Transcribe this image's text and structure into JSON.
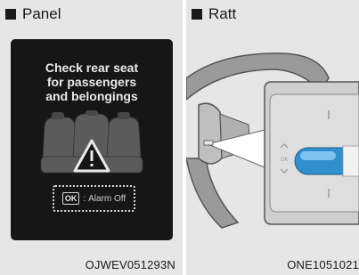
{
  "left_panel": {
    "heading": "Panel",
    "message_lines": [
      "Check rear seat",
      "for passengers",
      "and belongings"
    ],
    "ok_key": "OK",
    "ok_separator": ":",
    "ok_action": "Alarm Off",
    "caption": "OJWEV051293N"
  },
  "right_panel": {
    "heading": "Ratt",
    "switch_ok_label": "OK",
    "caption": "ONE1051021"
  },
  "colors": {
    "panel_bg": "#e6e6e6",
    "display_bg": "#161616",
    "ok_button_blue": "#3aa0d8"
  }
}
